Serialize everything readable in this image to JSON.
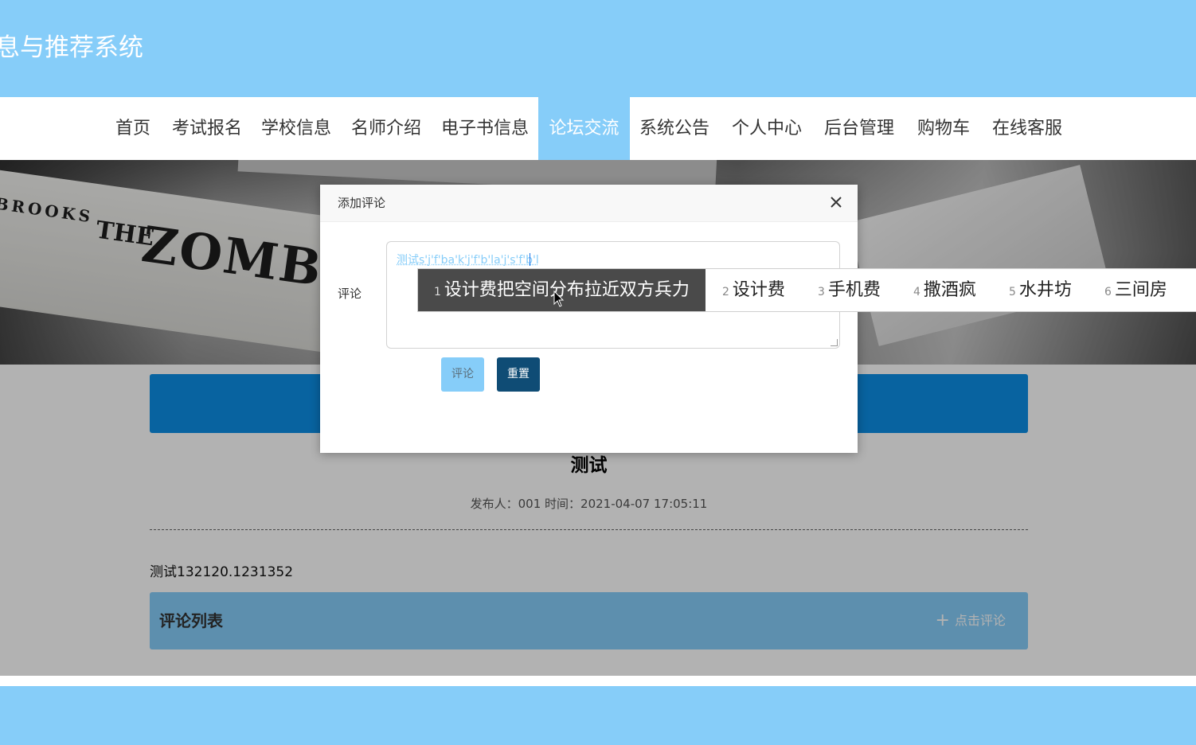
{
  "site": {
    "title": "息与推荐系统"
  },
  "nav": {
    "items": [
      {
        "label": "首页"
      },
      {
        "label": "考试报名"
      },
      {
        "label": "学校信息"
      },
      {
        "label": "名师介绍"
      },
      {
        "label": "电子书信息"
      },
      {
        "label": "论坛交流"
      },
      {
        "label": "系统公告"
      },
      {
        "label": "个人中心"
      },
      {
        "label": "后台管理"
      },
      {
        "label": "购物车"
      },
      {
        "label": "在线客服"
      }
    ],
    "active": "论坛交流"
  },
  "hero": {
    "book_text_1": "BROOKS",
    "book_text_2": "THE",
    "book_text_3": "ZOMB"
  },
  "post": {
    "title": "测试",
    "meta": "发布人：001 时间：2021-04-07 17:05:11",
    "body": "测试132120.1231352"
  },
  "comments": {
    "header": "评论列表",
    "add_label": "点击评论"
  },
  "modal": {
    "title": "添加评论",
    "close_icon": "close-icon",
    "field_label": "评论",
    "textarea_value": "测试s'j'f'ba'k'j'f'b'la'j's'f'b'l",
    "submit_label": "评论",
    "reset_label": "重置"
  },
  "ime": {
    "candidates": [
      {
        "num": "1",
        "text": "设计费把空间分布拉近双方兵力"
      },
      {
        "num": "2",
        "text": "设计费"
      },
      {
        "num": "3",
        "text": "手机费"
      },
      {
        "num": "4",
        "text": "撒酒疯"
      },
      {
        "num": "5",
        "text": "水井坊"
      },
      {
        "num": "6",
        "text": "三间房"
      }
    ],
    "selected": "1"
  },
  "colors": {
    "brand": "#86cdf9",
    "primary_button": "#0f4c75",
    "banner_blue": "#0c8fe6"
  }
}
